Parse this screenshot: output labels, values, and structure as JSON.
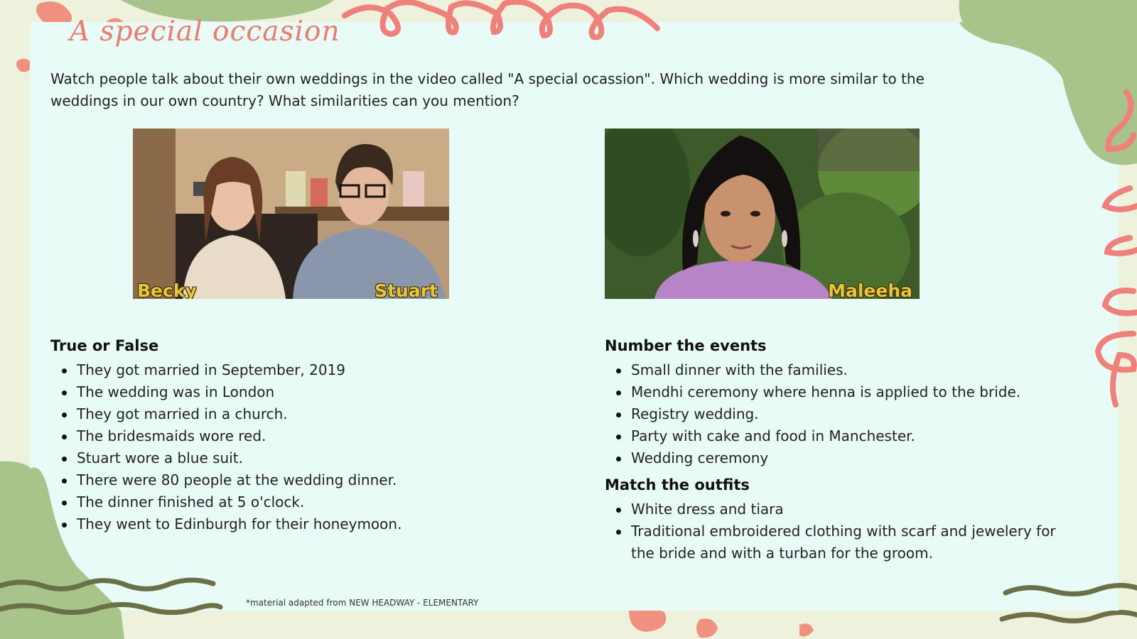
{
  "title": "A special occasion",
  "intro": "Watch people talk about their own weddings in the video called \"A special ocassion\". Which wedding is more similar to the weddings in our own country? What similarities can you mention?",
  "photo_left": {
    "caption_left": "Becky",
    "caption_right": "Stuart"
  },
  "photo_right": {
    "caption": "Maleeha"
  },
  "true_false": {
    "heading": "True or False",
    "items": [
      "They got married in September, 2019",
      "The wedding was in London",
      "They got married in a church.",
      "The bridesmaids wore red.",
      "Stuart wore a blue suit.",
      "There were 80 people at the wedding dinner.",
      "The dinner finished at 5 o'clock.",
      "They went to Edinburgh for their honeymoon."
    ]
  },
  "number_events": {
    "heading": "Number the events",
    "items": [
      "Small dinner with the families.",
      "Mendhi ceremony where henna is applied to the bride.",
      "Registry wedding.",
      "Party with cake and food in Manchester.",
      "Wedding ceremony"
    ]
  },
  "match_outfits": {
    "heading": "Match the outfits",
    "items": [
      "White dress and tiara",
      "Traditional embroidered clothing with scarf and jewelery for the bride and with a turban for the groom."
    ]
  },
  "footnote": "*material adapted from NEW HEADWAY - ELEMENTARY",
  "colors": {
    "accent": "#ec7b6e",
    "green": "#a9c48b",
    "panel": "#e8fbf6",
    "background": "#eef2dc"
  }
}
